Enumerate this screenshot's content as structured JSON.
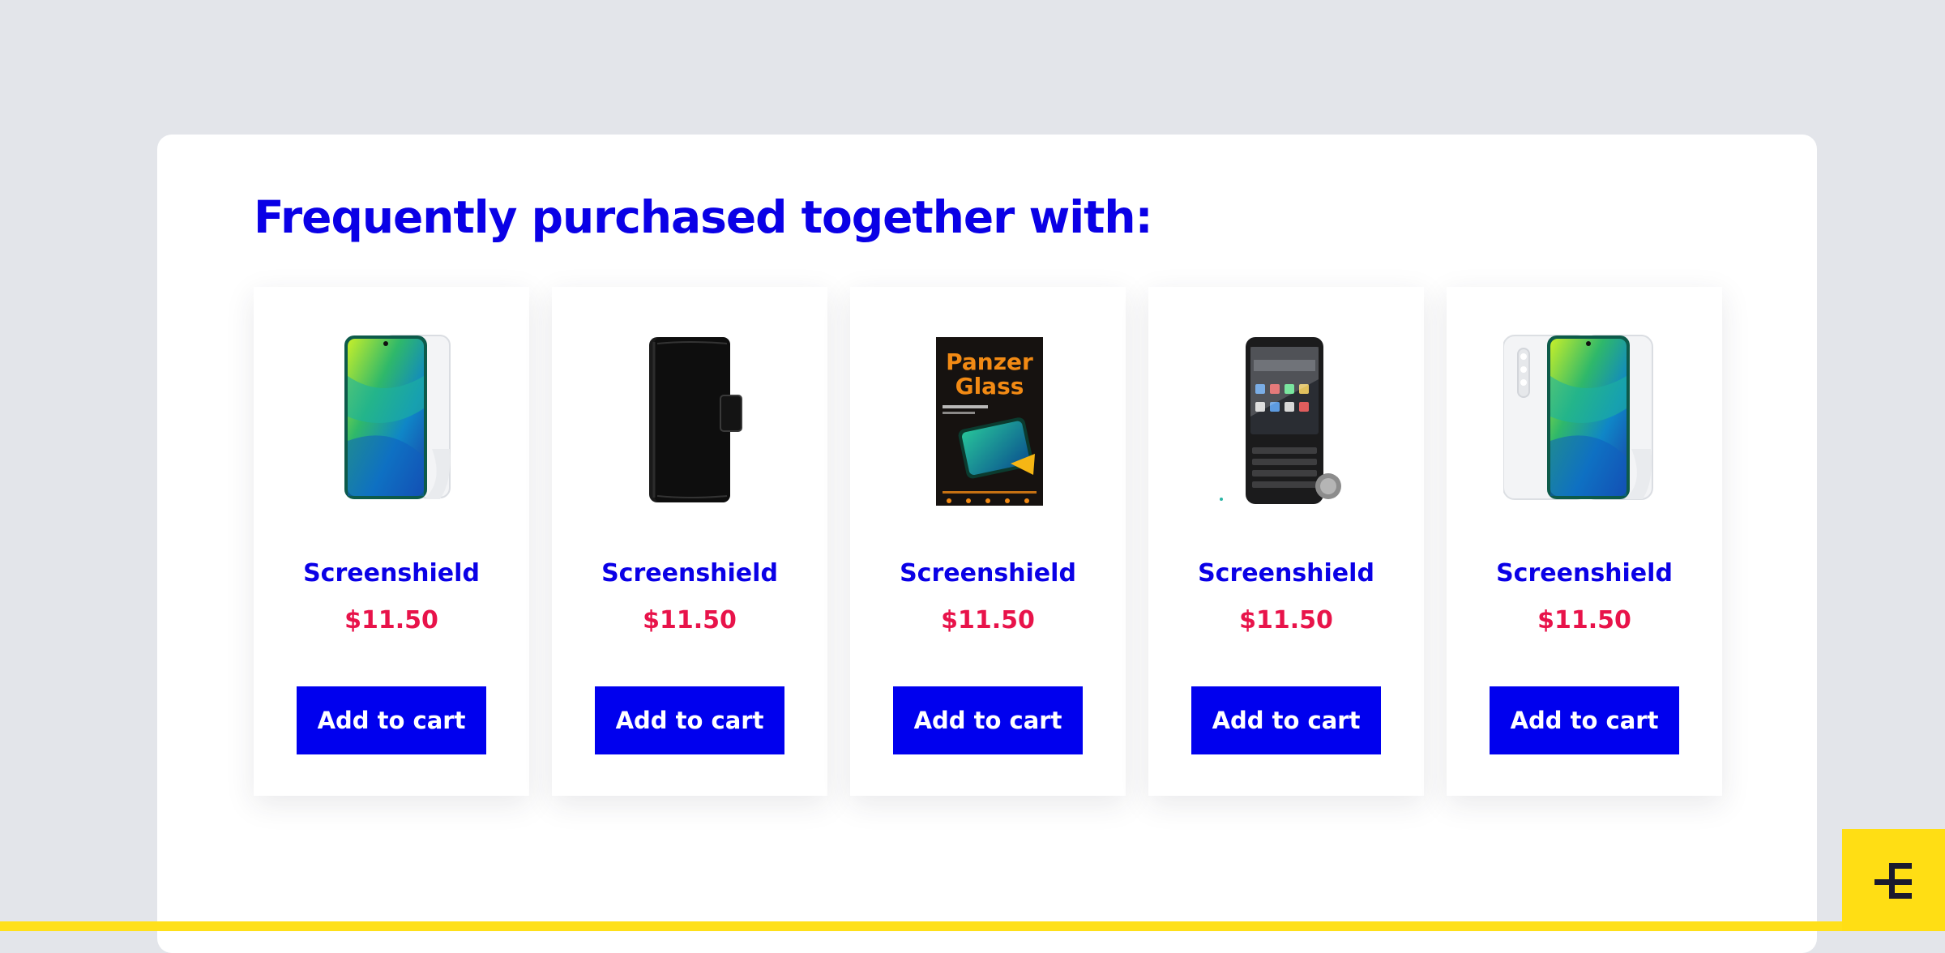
{
  "section": {
    "title": "Frequently purchased together with:"
  },
  "products": [
    {
      "name": "Screenshield",
      "price": "$11.50",
      "button_label": "Add to cart",
      "image_icon": "phone-screen-protector-icon"
    },
    {
      "name": "Screenshield",
      "price": "$11.50",
      "button_label": "Add to cart",
      "image_icon": "phone-wallet-case-icon"
    },
    {
      "name": "Screenshield",
      "price": "$11.50",
      "button_label": "Add to cart",
      "image_icon": "panzerglass-package-icon",
      "image_text": "Panzer Glass"
    },
    {
      "name": "Screenshield",
      "price": "$11.50",
      "button_label": "Add to cart",
      "image_icon": "keyboard-phone-protector-icon"
    },
    {
      "name": "Screenshield",
      "price": "$11.50",
      "button_label": "Add to cart",
      "image_icon": "phone-full-body-protector-icon"
    }
  ],
  "colors": {
    "accent": "#0a00e6",
    "button": "#0000ee",
    "price": "#e8134a",
    "brand_yellow": "#ffde14",
    "background": "#e3e5ea"
  },
  "brand": {
    "icon": "brand-logo-icon"
  }
}
